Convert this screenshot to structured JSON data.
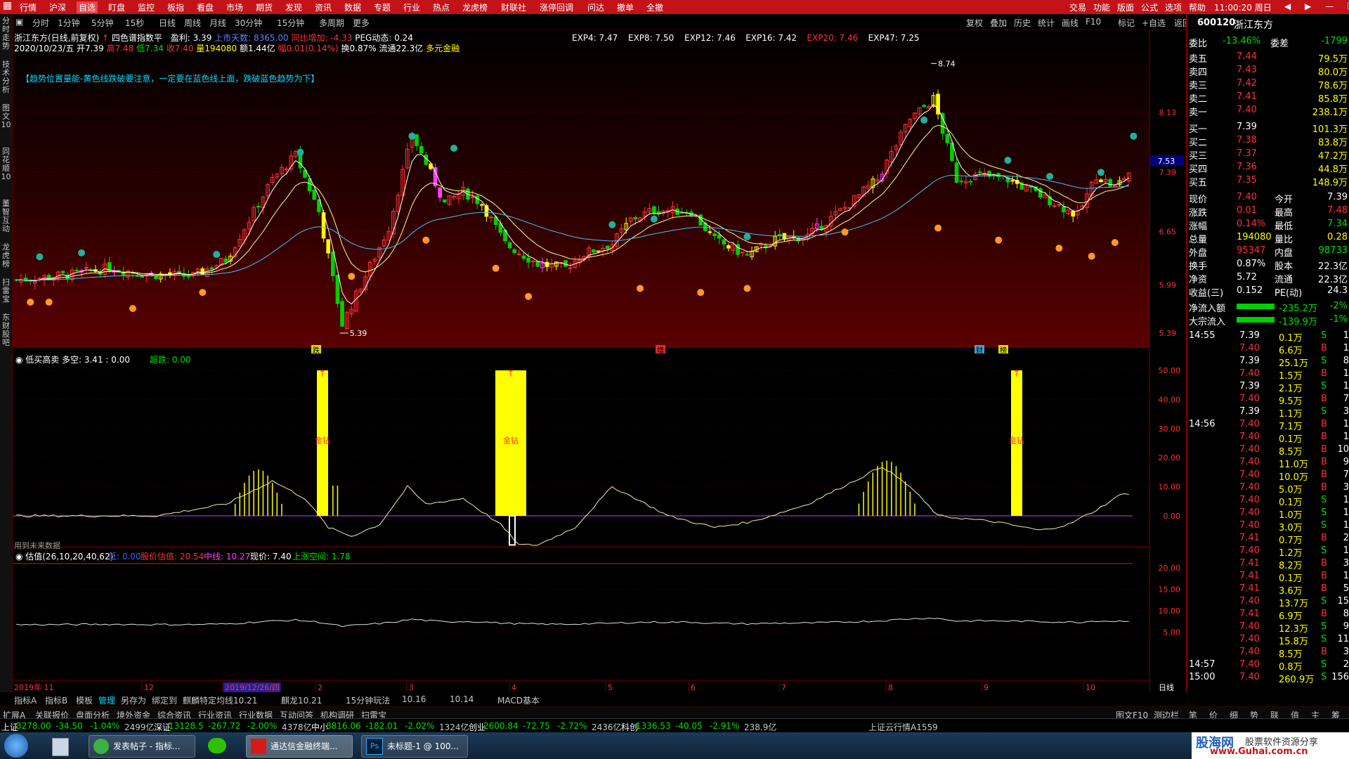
{
  "menu": [
    "行情",
    "沪深",
    "自选",
    "盯盘",
    "监控",
    "板指",
    "看盘",
    "市场",
    "期货",
    "发现",
    "资讯",
    "数据",
    "专题",
    "行业",
    "热点",
    "龙虎榜",
    "财联社",
    "涨停回调",
    "问达",
    "撤单",
    "全撤"
  ],
  "menu_right": [
    "交易",
    "功能",
    "版面",
    "公式",
    "选项",
    "帮助"
  ],
  "clock": "11:00:20 周日",
  "periods": [
    "分时",
    "1分钟",
    "5分钟",
    "15秒",
    "日线",
    "周线",
    "月线",
    "30分钟",
    "15分钟",
    "多周期",
    "更多"
  ],
  "toolbar_right": [
    "复权",
    "叠加",
    "历史",
    "统计",
    "画线",
    "F10",
    "标记",
    "+自选",
    "返回"
  ],
  "left_tabs": [
    "分时走势",
    "技术分析",
    "图文10",
    "同花顺10",
    "董智互动",
    "龙虎榜",
    "扫雷宝",
    "东财股吧"
  ],
  "stock": {
    "code": "600120",
    "name": "浙江东方"
  },
  "info1": {
    "title": "浙江东方(日线,前复权)",
    "indicator": "四色谱指数平",
    "ep": "盈利: 3.39",
    "days": "上市天数: 8365.00",
    "chg": "同比增加: -4.33",
    "pe": "PEG动态: 0.24"
  },
  "info2": {
    "date": "2020/10/23/五",
    "open": "开7.39",
    "high": "高7.48",
    "low": "低7.34",
    "close": "收7.40",
    "vol": "量194080",
    "amt": "额1.44亿",
    "amp": "幅0.01(0.14%)",
    "turn": "换0.87%",
    "flow": "流通22.3亿",
    "tag": "多元金融"
  },
  "exp_line": [
    {
      "t": "EXP4: 7.47",
      "c": "#ffffff"
    },
    {
      "t": "EXP8: 7.50",
      "c": "#ffffff"
    },
    {
      "t": "EXP12: 7.46",
      "c": "#ffffff"
    },
    {
      "t": "EXP16: 7.42",
      "c": "#ffffff"
    },
    {
      "t": "EXP20: 7.46",
      "c": "#ff3232"
    },
    {
      "t": "EXP47: 7.25",
      "c": "#ffffff"
    }
  ],
  "note": "【趋势位置量能-黄色线跌破要注意，一定要在蓝色线上面，跌破蓝色趋势为下】",
  "price_ticks": [
    "8.13",
    "7.39",
    "6.65",
    "5.99",
    "5.39"
  ],
  "current_price": "7.53",
  "peak_label": "8.74",
  "low_label": "5.39",
  "bottom_marks": [
    "跌",
    "增",
    "财",
    "榜"
  ],
  "panel2": {
    "title": "低买高卖",
    "ks": "多空: 3.41 : 0.00",
    "chao": "超跌: 0.00",
    "ticks": [
      "50.00",
      "40.00",
      "30.00",
      "20.00",
      "10.00",
      "0.00"
    ],
    "label": "金钻",
    "note": "用到未来数据"
  },
  "panel3": {
    "title": "估值(26,10,20,40,62)",
    "low": "低: 0.00",
    "est": "股价估值: 20.54",
    "mid": "中线: 10.27",
    "now": "现价: 7.40",
    "space": "上涨空间: 1.78",
    "ticks": [
      "20.00",
      "15.00",
      "10.00",
      "5.00"
    ]
  },
  "date_axis": [
    {
      "t": "2019年 11"
    },
    {
      "t": "12"
    },
    {
      "t": "2019/12/26/四",
      "hl": true
    },
    {
      "t": "2"
    },
    {
      "t": "3"
    },
    {
      "t": "4"
    },
    {
      "t": "5"
    },
    {
      "t": "6"
    },
    {
      "t": "7"
    },
    {
      "t": "8"
    },
    {
      "t": "9"
    },
    {
      "t": "10"
    }
  ],
  "day_label": "日线",
  "bottom_tabs1": [
    "指标A",
    "指标B",
    "模板",
    "管理",
    "另存为",
    "绑定到",
    "麒麟特定均线10.21",
    "麒龙10.21",
    "15分钟玩法",
    "10.16",
    "10.14",
    "MACD基本"
  ],
  "bottom_tabs2": [
    "扩展A",
    "关联报价",
    "盘面分析",
    "境外资金",
    "综合资讯",
    "行业资讯",
    "行业数据",
    "互动问答",
    "机构调研",
    "扫雷宝"
  ],
  "bottom_right": [
    "图文F10",
    "测边栏"
  ],
  "right_icons": [
    "笔",
    "价",
    "细",
    "势",
    "联",
    "值",
    "主",
    "筹"
  ],
  "status": [
    {
      "t": "上证",
      "c": "#ffffff"
    },
    {
      "t": "3278.00",
      "c": "#00e000"
    },
    {
      "t": "-34.50",
      "c": "#00e000"
    },
    {
      "t": "-1.04%",
      "c": "#00e000"
    },
    {
      "t": "2499亿",
      "c": "#c8c8c8"
    },
    {
      "t": "深证",
      "c": "#ffffff"
    },
    {
      "t": "13128.5",
      "c": "#00e000"
    },
    {
      "t": "-267.72",
      "c": "#00e000"
    },
    {
      "t": "-2.00%",
      "c": "#00e000"
    },
    {
      "t": "4378亿",
      "c": "#c8c8c8"
    },
    {
      "t": "中小",
      "c": "#ffffff"
    },
    {
      "t": "8816.06",
      "c": "#00e000"
    },
    {
      "t": "-182.01",
      "c": "#00e000"
    },
    {
      "t": "-2.02%",
      "c": "#00e000"
    },
    {
      "t": "1324亿",
      "c": "#c8c8c8"
    },
    {
      "t": "创业",
      "c": "#ffffff"
    },
    {
      "t": "2600.84",
      "c": "#00e000"
    },
    {
      "t": "-72.75",
      "c": "#00e000"
    },
    {
      "t": "-2.72%",
      "c": "#00e000"
    },
    {
      "t": "2436亿",
      "c": "#c8c8c8"
    },
    {
      "t": "科创",
      "c": "#ffffff"
    },
    {
      "t": "1336.53",
      "c": "#00e000"
    },
    {
      "t": "-40.05",
      "c": "#00e000"
    },
    {
      "t": "-2.91%",
      "c": "#00e000"
    },
    {
      "t": "238.9亿",
      "c": "#c8c8c8"
    },
    {
      "t": "上证云行情A1559",
      "c": "#c8c8c8"
    }
  ],
  "quote": {
    "webi": {
      "l1": "委比",
      "v1": "-13.46%",
      "l2": "委差",
      "v2": "-1799"
    },
    "asks": [
      {
        "l": "卖五",
        "p": "7.44",
        "v": "79.5万"
      },
      {
        "l": "卖四",
        "p": "7.43",
        "v": "80.0万"
      },
      {
        "l": "卖三",
        "p": "7.42",
        "v": "78.6万"
      },
      {
        "l": "卖二",
        "p": "7.41",
        "v": "85.8万"
      },
      {
        "l": "卖一",
        "p": "7.40",
        "v": "238.1万"
      }
    ],
    "bids": [
      {
        "l": "买一",
        "p": "7.39",
        "v": "101.3万"
      },
      {
        "l": "买二",
        "p": "7.38",
        "v": "83.8万"
      },
      {
        "l": "买三",
        "p": "7.37",
        "v": "47.2万"
      },
      {
        "l": "买四",
        "p": "7.36",
        "v": "44.8万"
      },
      {
        "l": "买五",
        "p": "7.35",
        "v": "148.9万"
      }
    ],
    "stats": [
      {
        "l1": "现价",
        "v1": "7.40",
        "c1": "#ff3232",
        "l2": "今开",
        "v2": "7.39",
        "c2": "#ffffff"
      },
      {
        "l1": "涨跌",
        "v1": "0.01",
        "c1": "#ff3232",
        "l2": "最高",
        "v2": "7.48",
        "c2": "#ff3232"
      },
      {
        "l1": "涨幅",
        "v1": "0.14%",
        "c1": "#ff3232",
        "l2": "最低",
        "v2": "7.34",
        "c2": "#00e000"
      },
      {
        "l1": "总量",
        "v1": "194080",
        "c1": "#ffff00",
        "l2": "量比",
        "v2": "0.28",
        "c2": "#ffff00"
      },
      {
        "l1": "外盘",
        "v1": "95347",
        "c1": "#ff3232",
        "l2": "内盘",
        "v2": "98733",
        "c2": "#00e000"
      },
      {
        "l1": "换手",
        "v1": "0.87%",
        "c1": "#ffffff",
        "l2": "股本",
        "v2": "22.3亿",
        "c2": "#ffffff"
      },
      {
        "l1": "净资",
        "v1": "5.72",
        "c1": "#ffffff",
        "l2": "流通",
        "v2": "22.3亿",
        "c2": "#ffffff"
      },
      {
        "l1": "收益(三)",
        "v1": "0.152",
        "c1": "#ffffff",
        "l2": "PE(动)",
        "v2": "24.3",
        "c2": "#ffffff"
      }
    ],
    "flows": [
      {
        "l": "净流入额",
        "v": "-235.2万",
        "p": "-2%"
      },
      {
        "l": "大宗流入",
        "v": "-139.9万",
        "p": "-1%"
      }
    ],
    "ticks": [
      {
        "t": "14:55",
        "p": "7.39",
        "v": "0.1万",
        "s": "S",
        "n": "1"
      },
      {
        "t": "",
        "p": "7.40",
        "v": "6.6万",
        "s": "B",
        "n": "1"
      },
      {
        "t": "",
        "p": "7.39",
        "v": "25.1万",
        "s": "S",
        "n": "8"
      },
      {
        "t": "",
        "p": "7.40",
        "v": "1.5万",
        "s": "B",
        "n": "1"
      },
      {
        "t": "",
        "p": "7.39",
        "v": "2.1万",
        "s": "S",
        "n": "1"
      },
      {
        "t": "",
        "p": "7.40",
        "v": "9.5万",
        "s": "B",
        "n": "7"
      },
      {
        "t": "",
        "p": "7.39",
        "v": "1.1万",
        "s": "S",
        "n": "3"
      },
      {
        "t": "14:56",
        "p": "7.40",
        "v": "7.1万",
        "s": "B",
        "n": "1"
      },
      {
        "t": "",
        "p": "7.40",
        "v": "0.1万",
        "s": "B",
        "n": "1"
      },
      {
        "t": "",
        "p": "7.40",
        "v": "8.5万",
        "s": "B",
        "n": "10"
      },
      {
        "t": "",
        "p": "7.40",
        "v": "11.0万",
        "s": "B",
        "n": "9"
      },
      {
        "t": "",
        "p": "7.40",
        "v": "10.0万",
        "s": "B",
        "n": "7"
      },
      {
        "t": "",
        "p": "7.40",
        "v": "5.0万",
        "s": "B",
        "n": "3"
      },
      {
        "t": "",
        "p": "7.40",
        "v": "0.1万",
        "s": "S",
        "n": "1"
      },
      {
        "t": "",
        "p": "7.40",
        "v": "1.0万",
        "s": "S",
        "n": "1"
      },
      {
        "t": "",
        "p": "7.40",
        "v": "3.0万",
        "s": "S",
        "n": "1"
      },
      {
        "t": "",
        "p": "7.41",
        "v": "0.7万",
        "s": "B",
        "n": "2"
      },
      {
        "t": "",
        "p": "7.40",
        "v": "1.2万",
        "s": "S",
        "n": "1"
      },
      {
        "t": "",
        "p": "7.41",
        "v": "8.2万",
        "s": "B",
        "n": "3"
      },
      {
        "t": "",
        "p": "7.41",
        "v": "0.1万",
        "s": "B",
        "n": "1"
      },
      {
        "t": "",
        "p": "7.41",
        "v": "3.6万",
        "s": "B",
        "n": "5"
      },
      {
        "t": "",
        "p": "7.40",
        "v": "13.7万",
        "s": "S",
        "n": "15"
      },
      {
        "t": "",
        "p": "7.41",
        "v": "6.9万",
        "s": "B",
        "n": "8"
      },
      {
        "t": "",
        "p": "7.40",
        "v": "12.3万",
        "s": "S",
        "n": "9"
      },
      {
        "t": "",
        "p": "7.40",
        "v": "15.8万",
        "s": "S",
        "n": "11"
      },
      {
        "t": "",
        "p": "7.40",
        "v": "8.5万",
        "s": "B",
        "n": "3"
      },
      {
        "t": "14:57",
        "p": "7.40",
        "v": "0.8万",
        "s": "S",
        "n": "2"
      },
      {
        "t": "15:00",
        "p": "7.40",
        "v": "260.9万",
        "s": "S",
        "n": "156"
      }
    ]
  },
  "taskbar": {
    "apps": [
      "发表帖子 - 指标...",
      "通达信金融终端...",
      "未标题-1 @ 100..."
    ],
    "watermark": "股海网",
    "watermark_sub": "股票软件资源分享",
    "watermark_url": "www.Guhai.com.cn"
  }
}
